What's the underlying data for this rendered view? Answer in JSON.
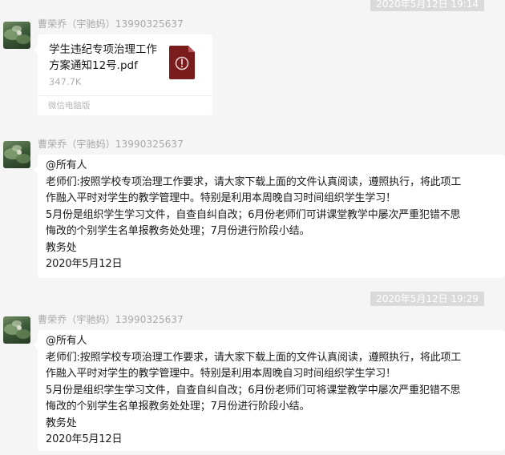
{
  "timestamps": {
    "top": "2020年5月12日  19:14",
    "middle": "2020年5月12日  19:29"
  },
  "file_message": {
    "sender": "曹荣乔（宇驰妈）13990325637",
    "file_name": "学生违纪专项治理工作方案通知12号.pdf",
    "file_size": "347.7K",
    "source": "微信电脑版",
    "file_icon": "pdf-file-icon",
    "file_icon_color": "#7b1c1c"
  },
  "text_messages": [
    {
      "sender": "曹荣乔（宇驰妈）13990325637",
      "lines": [
        "@所有人",
        "老师们:按照学校专项治理工作要求，请大家下载上面的文件认真阅读，遵照执行，将此项工",
        "作融入平时对学生的教学管理中。特别是利用本周晚自习时间组织学生学习！",
        "5月份是组织学生学习文件，自查自纠自改；6月份老师们可讲课堂教学中屡次严重犯错不思",
        "悔改的个别学生名单报教务处处理；7月份进行阶段小结。",
        "教务处",
        "2020年5月12日"
      ]
    },
    {
      "sender": "曹荣乔（宇驰妈）13990325637",
      "lines": [
        "@所有人",
        "老师们:按照学校专项治理工作要求，请大家下载上面的文件认真阅读，遵照执行，将此项工",
        "作融入平时对学生的教学管理中。特别是利用本周晚自习时间组织学生学习！",
        "5月份是组织学生学习文件，自查自纠自改；6月份老师们可将课堂教学中屡次严重犯错不思",
        "悔改的个别学生名单报教务处处理；7月份进行阶段小结。",
        "教务处",
        "2020年5月12日"
      ]
    }
  ]
}
